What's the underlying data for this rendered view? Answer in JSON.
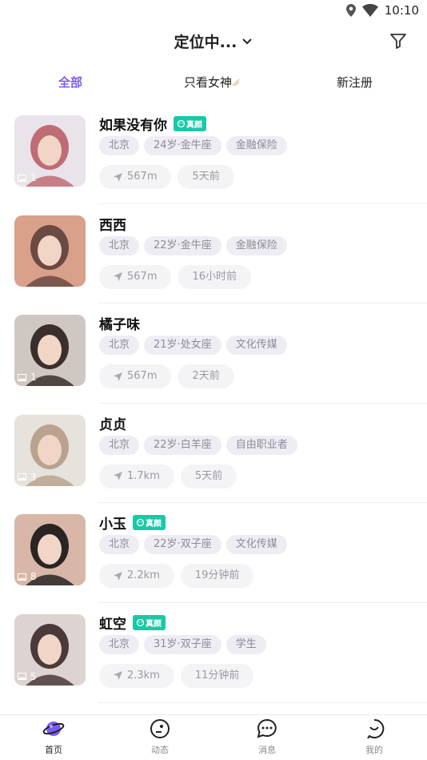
{
  "status_bar": {
    "time": "10:10"
  },
  "header": {
    "title": "定位中..."
  },
  "tabs": [
    {
      "label": "全部",
      "active": true
    },
    {
      "label": "只看女神",
      "active": false
    },
    {
      "label": "新注册",
      "active": false
    }
  ],
  "users": [
    {
      "name": "如果没有你",
      "verified": true,
      "verified_label": "真颜",
      "photo_count": "1",
      "city": "北京",
      "age_sign": "24岁·金牛座",
      "job": "金融保险",
      "distance": "567m",
      "last_seen": "5天前",
      "avatar_colors": [
        "#e8e4ea",
        "#c06c75"
      ]
    },
    {
      "name": "西西",
      "verified": false,
      "verified_label": "",
      "photo_count": "",
      "city": "北京",
      "age_sign": "22岁·金牛座",
      "job": "金融保险",
      "distance": "567m",
      "last_seen": "16小时前",
      "avatar_colors": [
        "#d9a08a",
        "#6b4a44"
      ]
    },
    {
      "name": "橘子味",
      "verified": false,
      "verified_label": "",
      "photo_count": "1",
      "city": "北京",
      "age_sign": "21岁·处女座",
      "job": "文化传媒",
      "distance": "567m",
      "last_seen": "2天前",
      "avatar_colors": [
        "#cfc7c2",
        "#3a2f2c"
      ]
    },
    {
      "name": "贞贞",
      "verified": false,
      "verified_label": "",
      "photo_count": "3",
      "city": "北京",
      "age_sign": "22岁·白羊座",
      "job": "自由职业者",
      "distance": "1.7km",
      "last_seen": "5天前",
      "avatar_colors": [
        "#e6e2dc",
        "#b9a38e"
      ]
    },
    {
      "name": "小玉",
      "verified": true,
      "verified_label": "真颜",
      "photo_count": "8",
      "city": "北京",
      "age_sign": "22岁·双子座",
      "job": "文化传媒",
      "distance": "2.2km",
      "last_seen": "19分钟前",
      "avatar_colors": [
        "#d8b7a8",
        "#2a2423"
      ]
    },
    {
      "name": "虹空",
      "verified": true,
      "verified_label": "真颜",
      "photo_count": "5",
      "city": "北京",
      "age_sign": "31岁·双子座",
      "job": "学生",
      "distance": "2.3km",
      "last_seen": "11分钟前",
      "avatar_colors": [
        "#ddd3d0",
        "#4a3a3a"
      ]
    }
  ],
  "bottom_nav": [
    {
      "label": "首页",
      "icon": "planet-icon",
      "active": true
    },
    {
      "label": "动态",
      "icon": "eye-face-icon",
      "active": false
    },
    {
      "label": "消息",
      "icon": "chat-bubble-icon",
      "active": false
    },
    {
      "label": "我的",
      "icon": "smile-face-icon",
      "active": false
    }
  ],
  "colors": {
    "accent": "#7b5cf0",
    "verified": "#19c9a6",
    "tag_bg": "#eeedf3"
  }
}
